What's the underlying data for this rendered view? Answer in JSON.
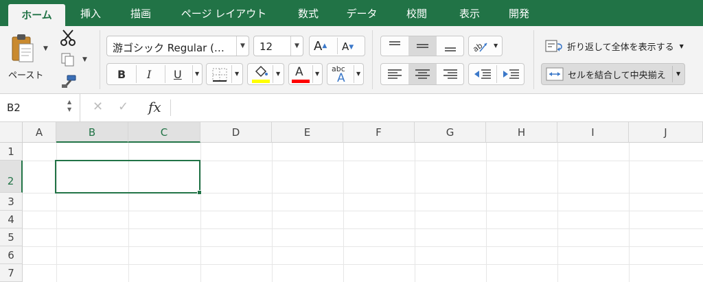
{
  "ribbon_tabs": [
    "ホーム",
    "挿入",
    "描画",
    "ページ レイアウト",
    "数式",
    "データ",
    "校閲",
    "表示",
    "開発"
  ],
  "active_tab": "ホーム",
  "clipboard": {
    "paste_label": "ペースト"
  },
  "font": {
    "name": "游ゴシック Regular (…",
    "size": "12",
    "grow_label": "A",
    "shrink_label": "A",
    "bold_label": "B",
    "italic_label": "I",
    "underline_label": "U",
    "fill_color": "#ffff00",
    "font_color": "#ff0000",
    "font_color_label": "A",
    "phonetic_top": "abc",
    "phonetic_bottom": "A"
  },
  "alignment": {
    "wrap_text_label": "折り返して全体を表示する",
    "merge_center_label": "セルを結合して中央揃え"
  },
  "formula_bar": {
    "name_box": "B2",
    "formula": "",
    "fx_label": "fx"
  },
  "grid": {
    "columns": [
      "A",
      "B",
      "C",
      "D",
      "E",
      "F",
      "G",
      "H",
      "I",
      "J"
    ],
    "rows": [
      "1",
      "2",
      "3",
      "4",
      "5",
      "6",
      "7"
    ],
    "selected_cell": "B2",
    "selected_range": "B2:C2"
  },
  "colors": {
    "accent": "#217346",
    "ribbon_bg": "#f3f3f3",
    "highlight": "#ffff00",
    "font_red": "#ff0000"
  }
}
